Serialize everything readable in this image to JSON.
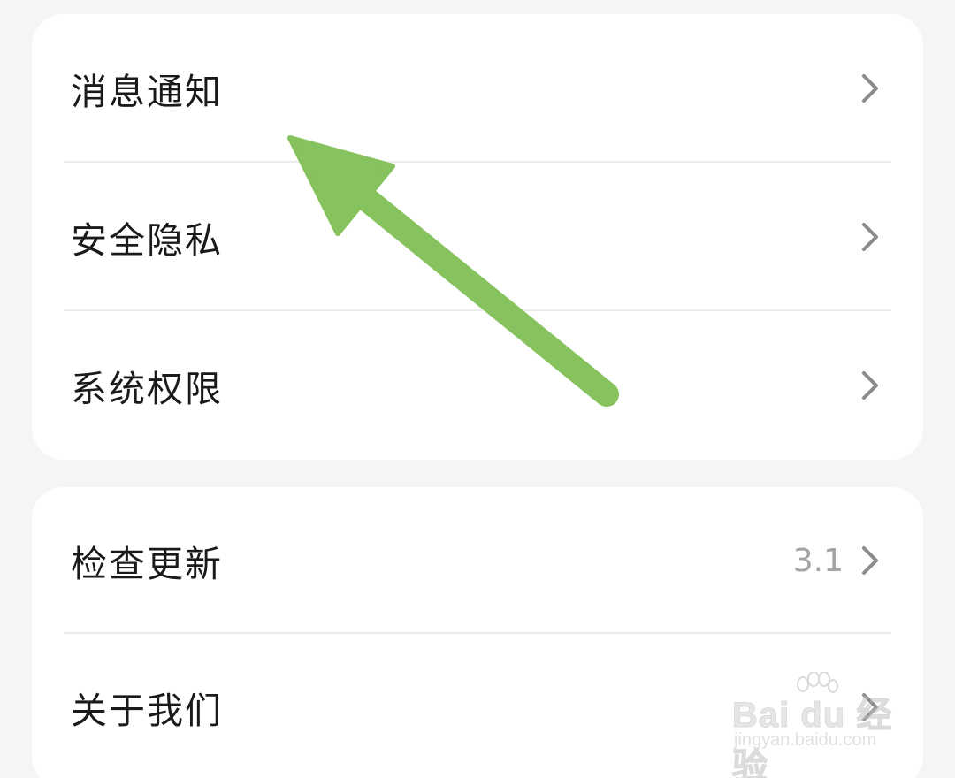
{
  "settings_group_1": {
    "items": [
      {
        "label": "消息通知"
      },
      {
        "label": "安全隐私"
      },
      {
        "label": "系统权限"
      }
    ]
  },
  "settings_group_2": {
    "items": [
      {
        "label": "检查更新",
        "value": "3.1"
      },
      {
        "label": "关于我们"
      }
    ]
  },
  "annotation": {
    "arrow_color": "#86c35f"
  },
  "watermark": {
    "brand": "Bai du 经验",
    "url": "jingyan.baidu.com"
  },
  "colors": {
    "background": "#f4f5f7",
    "card": "#ffffff",
    "label_text": "#1a1a1a",
    "secondary_text": "#a3a3a3",
    "chevron": "#8c8c8c"
  },
  "icons": {
    "chevron": "chevron-right-icon",
    "annotation": "arrow-annotation-icon",
    "watermark_logo": "paw-logo-icon"
  }
}
